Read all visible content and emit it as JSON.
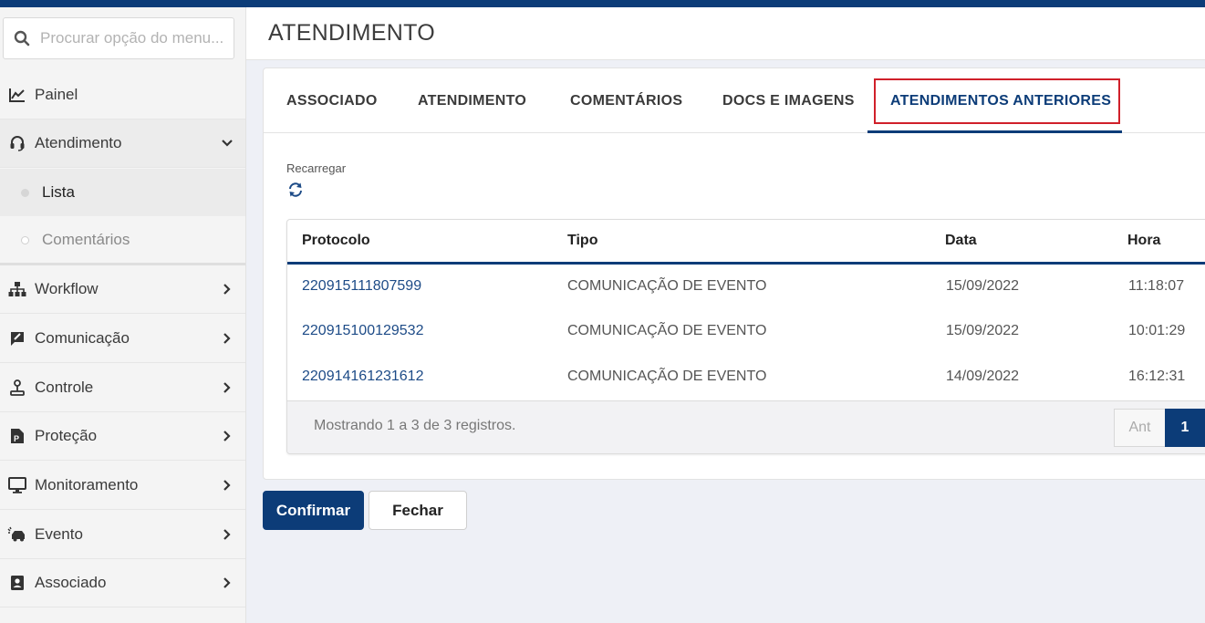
{
  "sidebar": {
    "search": {
      "placeholder": "Procurar opção do menu..."
    },
    "items": [
      {
        "id": "painel",
        "label": "Painel",
        "icon": "chart-line-icon"
      },
      {
        "id": "atendimento",
        "label": "Atendimento",
        "icon": "headset-icon",
        "expanded": true,
        "children": [
          {
            "label": "Lista"
          },
          {
            "label": "Comentários"
          }
        ]
      },
      {
        "id": "workflow",
        "label": "Workflow",
        "icon": "sitemap-icon"
      },
      {
        "id": "comunicacao",
        "label": "Comunicação",
        "icon": "comment-edit-icon"
      },
      {
        "id": "controle",
        "label": "Controle",
        "icon": "joystick-icon"
      },
      {
        "id": "protecao",
        "label": "Proteção",
        "icon": "document-p-icon"
      },
      {
        "id": "monitoramento",
        "label": "Monitoramento",
        "icon": "monitor-icon"
      },
      {
        "id": "evento",
        "label": "Evento",
        "icon": "car-crash-icon"
      },
      {
        "id": "associado",
        "label": "Associado",
        "icon": "contact-card-icon"
      }
    ]
  },
  "header": {
    "title": "ATENDIMENTO"
  },
  "tabs": [
    {
      "label": "ASSOCIADO"
    },
    {
      "label": "ATENDIMENTO"
    },
    {
      "label": "COMENTÁRIOS"
    },
    {
      "label": "DOCS E IMAGENS"
    },
    {
      "label": "ATENDIMENTOS ANTERIORES",
      "active": true
    }
  ],
  "reload": {
    "label": "Recarregar"
  },
  "table": {
    "columns": [
      "Protocolo",
      "Tipo",
      "Data",
      "Hora"
    ],
    "rows": [
      [
        "220915111807599",
        "COMUNICAÇÃO DE EVENTO",
        "15/09/2022",
        "11:18:07"
      ],
      [
        "220915100129532",
        "COMUNICAÇÃO DE EVENTO",
        "15/09/2022",
        "10:01:29"
      ],
      [
        "220914161231612",
        "COMUNICAÇÃO DE EVENTO",
        "14/09/2022",
        "16:12:31"
      ]
    ],
    "footer_info": "Mostrando 1 a 3 de 3 registros.",
    "pagination": {
      "prev": "Ant",
      "current": "1"
    }
  },
  "actions": {
    "confirm": "Confirmar",
    "close": "Fechar"
  },
  "colors": {
    "primary": "#0c3c78",
    "highlight": "#d0202a",
    "link": "#1d4b87"
  }
}
